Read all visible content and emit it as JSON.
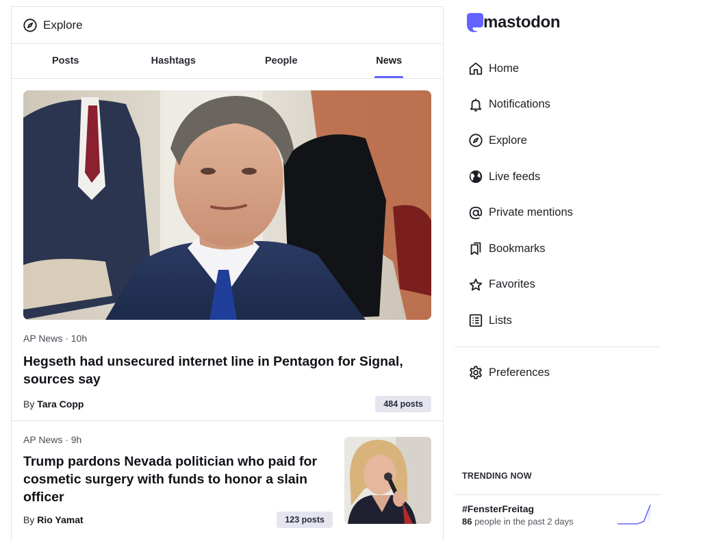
{
  "header": {
    "title": "Explore",
    "icon": "compass-icon"
  },
  "tabs": [
    {
      "label": "Posts",
      "active": false
    },
    {
      "label": "Hashtags",
      "active": false
    },
    {
      "label": "People",
      "active": false
    },
    {
      "label": "News",
      "active": true
    }
  ],
  "stories": [
    {
      "source": "AP News",
      "age": "10h",
      "meta": "AP News · 10h",
      "headline": "Hegseth had unsecured internet line in Pentagon for Signal, sources say",
      "by": "By",
      "author": "Tara Copp",
      "posts": "484 posts",
      "image": "man-in-suit-photo"
    },
    {
      "source": "AP News",
      "age": "9h",
      "meta": "AP News · 9h",
      "headline": "Trump pardons Nevada politician who paid for cosmetic surgery with funds to honor a slain officer",
      "by": "By",
      "author": "Rio Yamat",
      "posts": "123 posts",
      "image": "woman-speaking-photo"
    }
  ],
  "brand": {
    "name": "mastodon",
    "accent": "#6364ff"
  },
  "nav": {
    "items": [
      {
        "label": "Home",
        "icon": "home-icon"
      },
      {
        "label": "Notifications",
        "icon": "bell-icon"
      },
      {
        "label": "Explore",
        "icon": "compass-icon"
      },
      {
        "label": "Live feeds",
        "icon": "globe-icon"
      },
      {
        "label": "Private mentions",
        "icon": "at-icon"
      },
      {
        "label": "Bookmarks",
        "icon": "bookmarks-icon"
      },
      {
        "label": "Favorites",
        "icon": "star-icon"
      },
      {
        "label": "Lists",
        "icon": "list-icon"
      }
    ],
    "preferences": {
      "label": "Preferences",
      "icon": "gear-icon"
    }
  },
  "trending": {
    "title": "TRENDING NOW",
    "items": [
      {
        "tag": "#FensterFreitag",
        "count": "86",
        "suffix": " people in the past 2 days",
        "trend": [
          0,
          0,
          0,
          0,
          1,
          8
        ]
      }
    ]
  }
}
